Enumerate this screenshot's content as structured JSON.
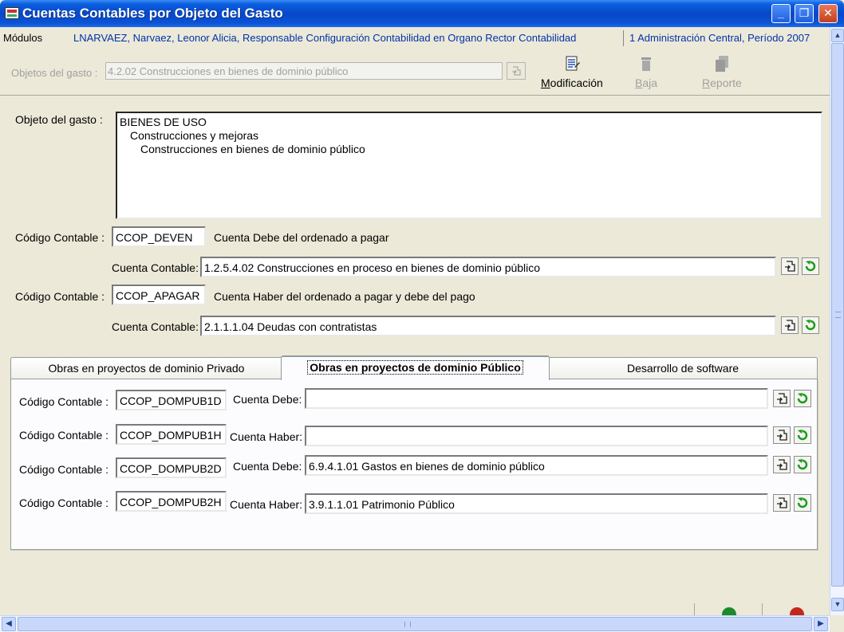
{
  "window": {
    "title": "Cuentas Contables por Objeto del Gasto",
    "min_label": "_",
    "restore_label": "❐",
    "close_label": "✕"
  },
  "menubar": {
    "modulos": "Módulos",
    "user": "LNARVAEZ, Narvaez, Leonor Alicia, Responsable Configuración Contabilidad en Organo Rector Contabilidad",
    "entity": "1 Administración Central, Período 2007"
  },
  "toolbar": {
    "obj_label": "Objetos del gasto :",
    "obj_value": "4.2.02 Construcciones en bienes de dominio público",
    "modificacion_first": "M",
    "modificacion_rest": "odificación",
    "baja_first": "B",
    "baja_rest": "aja",
    "reporte_first": "R",
    "reporte_rest": "eporte"
  },
  "form": {
    "objeto_label": "Objeto del gasto :",
    "tree": [
      "BIENES DE USO",
      "Construcciones y mejoras",
      "Construcciones en bienes de dominio público"
    ],
    "codigo_label": "Código Contable :",
    "cuenta_label": "Cuenta Contable:",
    "rows": [
      {
        "code": "CCOP_DEVEN",
        "desc": "Cuenta Debe del ordenado a pagar",
        "cuenta": "1.2.5.4.02 Construcciones en proceso en bienes de dominio público"
      },
      {
        "code": "CCOP_APAGAR",
        "desc": "Cuenta Haber del ordenado a pagar y debe del pago",
        "cuenta": "2.1.1.1.04 Deudas con contratistas"
      }
    ]
  },
  "tabs": [
    {
      "label": "Obras en proyectos de dominio Privado"
    },
    {
      "label": "Obras en proyectos de dominio Público"
    },
    {
      "label": "Desarrollo de software"
    }
  ],
  "tab_panel": {
    "codigo_label": "Código Contable :",
    "rows": [
      {
        "code": "CCOP_DOMPUB1D",
        "cuenta_label": "Cuenta Debe:",
        "value": ""
      },
      {
        "code": "CCOP_DOMPUB1H",
        "cuenta_label": "Cuenta Haber:",
        "value": ""
      },
      {
        "code": "CCOP_DOMPUB2D",
        "cuenta_label": "Cuenta Debe:",
        "value": "6.9.4.1.01 Gastos en bienes de dominio público"
      },
      {
        "code": "CCOP_DOMPUB2H",
        "cuenta_label": "Cuenta Haber:",
        "value": "3.9.1.1.01 Patrimonio Público"
      }
    ]
  },
  "colors": {
    "titlebar": "#0848c8",
    "link_blue": "#0033aa",
    "refresh_green": "#1a9a1a",
    "tab_highlight": "#e8a94d"
  },
  "icons": {
    "search": "search-icon",
    "refresh": "refresh-icon",
    "modify": "modify-icon",
    "delete": "trash-icon",
    "report": "report-icon"
  }
}
